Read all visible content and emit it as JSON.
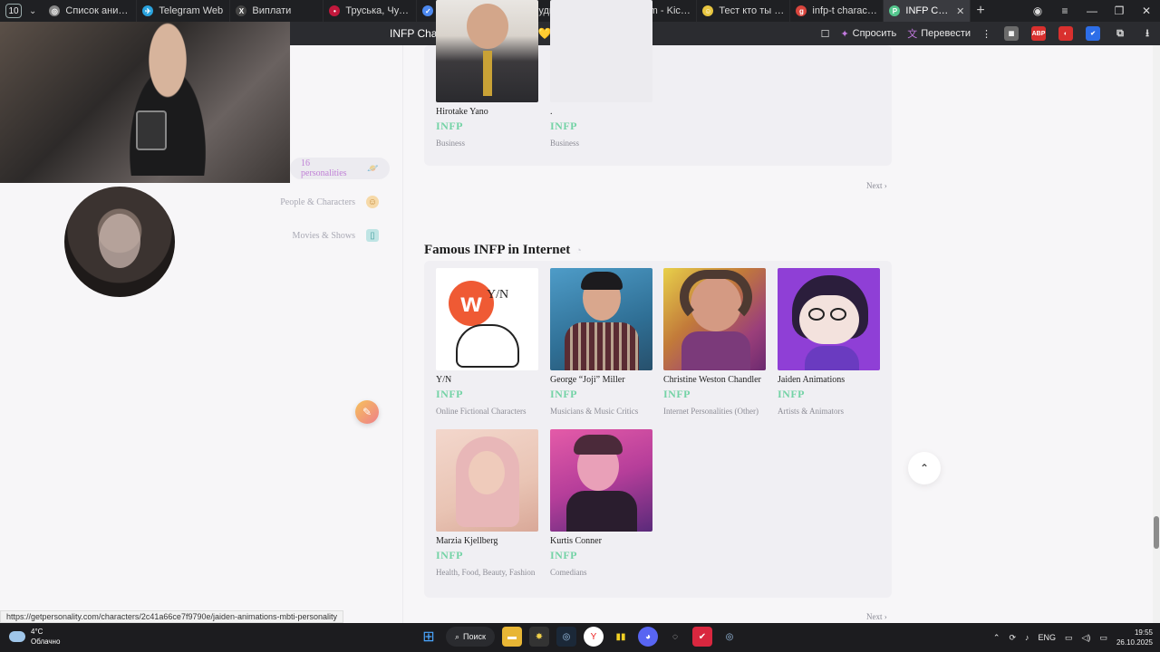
{
  "browser": {
    "tab_counter": "10",
    "tabs": [
      {
        "label": "Список аниме / у",
        "color": "#888888",
        "glyph": "◎"
      },
      {
        "label": "Telegram Web",
        "color": "#2aa3de",
        "glyph": "✈"
      },
      {
        "label": "Виплати",
        "color": "#444444",
        "glyph": "X"
      },
      {
        "label": "Труська, Чулко и",
        "color": "#c2183c",
        "glyph": "•"
      },
      {
        "label": "Будильник онлай",
        "color": "#4d89f0",
        "glyph": "✓"
      },
      {
        "label": "Будильник онлай",
        "color": "#4d89f0",
        "glyph": "✓"
      },
      {
        "label": "Stream - Kick Dest",
        "color": "#2be04b",
        "glyph": "K"
      },
      {
        "label": "Тест кто ты из 'иг",
        "color": "#e8c640",
        "glyph": "☺"
      },
      {
        "label": "infp-t characters",
        "color": "#d9453d",
        "glyph": "g"
      },
      {
        "label": "INFP Characte",
        "color": "#55c78e",
        "glyph": "P",
        "active": true
      }
    ],
    "page_title": "INFP Characters & Celebrities 💛",
    "ask_label": "Спросить",
    "translate_label": "Перевести",
    "status_url": "https://getpersonality.com/characters/2c41a66ce7f9790e/jaiden-animations-mbti-personality"
  },
  "sidebar": {
    "items": [
      {
        "label": "16 personalities",
        "icon": "planet-icon",
        "active": true
      },
      {
        "label": "People & Characters",
        "icon": "person-icon",
        "active": false
      },
      {
        "label": "Movies & Shows",
        "icon": "book-icon",
        "active": false
      }
    ]
  },
  "business_section": {
    "cards": [
      {
        "name": "Hirotake Yano",
        "type": "INFP",
        "category": "Business"
      },
      {
        "name": ".",
        "type": "INFP",
        "category": "Business"
      }
    ],
    "next_label": "Next ›"
  },
  "internet_section": {
    "title": "Famous INFP in Internet",
    "cards": [
      {
        "name": "Y/N",
        "type": "INFP",
        "category": "Online Fictional Characters"
      },
      {
        "name": "George “Joji” Miller",
        "type": "INFP",
        "category": "Musicians & Music Critics"
      },
      {
        "name": "Christine Weston Chandler",
        "type": "INFP",
        "category": "Internet Personalities (Other)"
      },
      {
        "name": "Jaiden Animations",
        "type": "INFP",
        "category": "Artists & Animators"
      },
      {
        "name": "Marzia Kjellberg",
        "type": "INFP",
        "category": "Health, Food, Beauty, Fashion"
      },
      {
        "name": "Kurtis Conner",
        "type": "INFP",
        "category": "Comedians"
      }
    ],
    "next_label": "Next ›"
  },
  "taskbar": {
    "weather_temp": "4°C",
    "weather_desc": "Облачно",
    "search_label": "Поиск",
    "lang": "ENG",
    "time": "19:55",
    "date": "26.10.2025"
  },
  "colors": {
    "type_green": "#74d3a6",
    "accent_purple": "#c081d6"
  }
}
